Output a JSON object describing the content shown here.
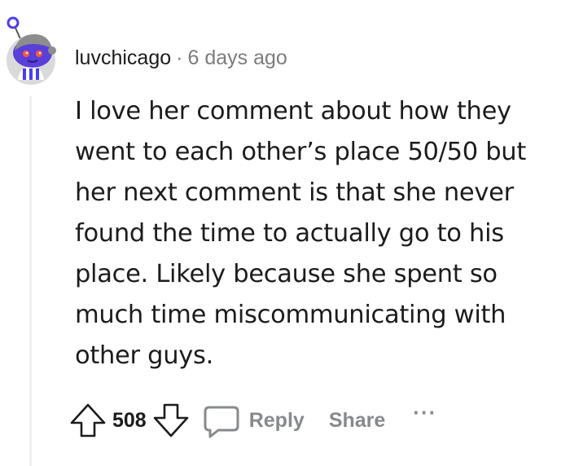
{
  "comment": {
    "username": "luvchicago",
    "separator": "·",
    "timestamp": "6 days ago",
    "body": "I love her comment about how they went to each other’s place 50/50 but her next comment is that she never found the time to actually go to his place. Likely because she spent so much time miscommunicating with other guys.",
    "avatar_icon": "snoo-avatar-icon"
  },
  "actions": {
    "upvote_icon": "upvote-arrow-icon",
    "vote_count": "508",
    "downvote_icon": "downvote-arrow-icon",
    "reply_icon": "comment-bubble-icon",
    "reply_label": "Reply",
    "share_label": "Share",
    "more_label": "···"
  },
  "colors": {
    "text": "#1c1c1c",
    "muted": "#878a8c",
    "thread_line": "#edeff1",
    "avatar_bg": "#dadada",
    "avatar_accent": "#4b3df0"
  }
}
